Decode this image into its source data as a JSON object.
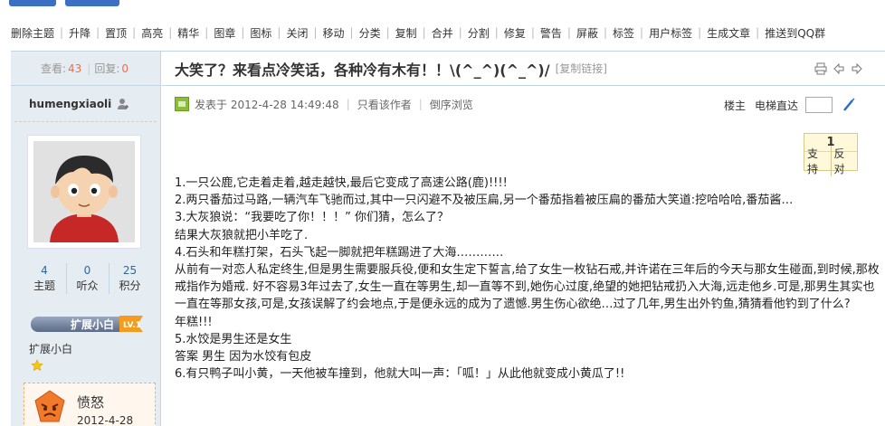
{
  "moderation": {
    "items": [
      "删除主题",
      "升降",
      "置顶",
      "高亮",
      "精华",
      "图章",
      "图标",
      "关闭",
      "移动",
      "分类",
      "复制",
      "合并",
      "分割",
      "修复",
      "警告",
      "屏蔽",
      "标签",
      "用户标签",
      "生成文章",
      "推送到QQ群"
    ]
  },
  "thread": {
    "views_label": "查看:",
    "views": "43",
    "replies_label": "回复:",
    "replies": "0",
    "title": "大笑了？来看点冷笑话，各种冷有木有！！\\(^_^)(^_^)/",
    "copy_link": "[复制链接]"
  },
  "author": {
    "name": "humengxiaoli",
    "stats": [
      {
        "value": "4",
        "label": "主题"
      },
      {
        "value": "0",
        "label": "听众"
      },
      {
        "value": "25",
        "label": "积分"
      }
    ],
    "group_badge": "扩展小白",
    "group_badge_tag": "LV.1",
    "group": "扩展小白",
    "mood": "愤怒",
    "mood_date": "2012-4-28"
  },
  "post_meta": {
    "posted": "发表于 2012-4-28 14:49:48",
    "only_author": "只看该作者",
    "reverse": "倒序浏览",
    "floor": "楼主",
    "elevator": "电梯直达"
  },
  "vote": {
    "count": "1",
    "support": "支持",
    "oppose": "反对"
  },
  "body": [
    "1.一只公鹿,它走着走着,越走越快,最后它变成了高速公路(鹿)!!!!",
    "2.两只番茄过马路,一辆汽车飞驰而过,其中一只闪避不及被压扁,另一个番茄指着被压扁的番茄大笑道:挖哈哈哈,番茄酱…",
    "3.大灰狼说：“我要吃了你！！！” 你们猜，怎么了？",
    "结果大灰狼就把小羊吃了.",
    "4.石头和年糕打架，石头飞起一脚就把年糕踢进了大海…………",
    "从前有一对恋人私定终生,但是男生需要服兵役,便和女生定下誓言,给了女生一枚钻石戒,并许诺在三年后的今天与那女生碰面,到时候,那枚戒指作为婚戒. 好不容易3年过去了,女生一直在等男生,却一直等不到,她伤心过度,绝望的她把钻戒扔入大海,远走他乡.可是,那男生其实也一直在等那女孩,可是,女孩误解了约会地点,于是便永远的成为了遗憾.男生伤心欲绝…过了几年,男生出外钓鱼,猜猜看他钓到了什么?",
    "年糕!!!",
    "5.水饺是男生还是女生",
    "答案 男生 因为水饺有包皮",
    "6.有只鸭子叫小黄，一天他被车撞到，他就大叫一声：「呱！」从此他就变成小黄瓜了!!"
  ]
}
